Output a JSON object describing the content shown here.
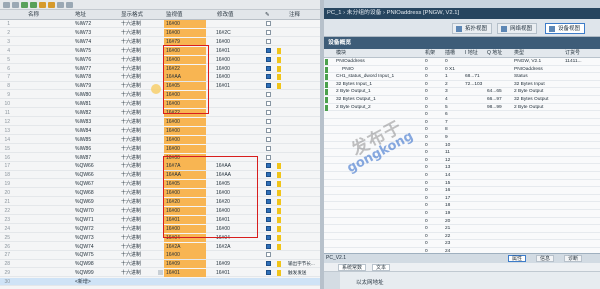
{
  "watch": {
    "headers": [
      "名称",
      "地址",
      "显示格式",
      "监视值",
      "修改值",
      "注释"
    ],
    "rows": [
      {
        "n": "1",
        "addr": "%IW72",
        "fmt": "十六进制",
        "mon": "16#00",
        "mod": "",
        "cb": false,
        "warn": false,
        "note": ""
      },
      {
        "n": "2",
        "addr": "%IW73",
        "fmt": "十六进制",
        "mon": "16#00",
        "mod": "16#2C",
        "cb": false,
        "warn": false,
        "note": ""
      },
      {
        "n": "3",
        "addr": "%IW74",
        "fmt": "十六进制",
        "mon": "16#79",
        "mod": "16#00",
        "cb": false,
        "warn": false,
        "note": ""
      },
      {
        "n": "4",
        "addr": "%IW75",
        "fmt": "十六进制",
        "mon": "16#00",
        "mod": "16#01",
        "cb": true,
        "warn": true,
        "note": ""
      },
      {
        "n": "5",
        "addr": "%IW76",
        "fmt": "十六进制",
        "mon": "16#00",
        "mod": "16#00",
        "cb": true,
        "warn": true,
        "note": ""
      },
      {
        "n": "6",
        "addr": "%IW77",
        "fmt": "十六进制",
        "mon": "16#22",
        "mod": "16#00",
        "cb": true,
        "warn": true,
        "note": ""
      },
      {
        "n": "7",
        "addr": "%IW78",
        "fmt": "十六进制",
        "mon": "16#AA",
        "mod": "16#00",
        "cb": true,
        "warn": true,
        "note": ""
      },
      {
        "n": "8",
        "addr": "%IW79",
        "fmt": "十六进制",
        "mon": "16#05",
        "mod": "16#01",
        "cb": true,
        "warn": true,
        "note": ""
      },
      {
        "n": "9",
        "addr": "%IW80",
        "fmt": "十六进制",
        "mon": "16#00",
        "mod": "",
        "cb": false,
        "warn": false,
        "note": ""
      },
      {
        "n": "10",
        "addr": "%IW81",
        "fmt": "十六进制",
        "mon": "16#00",
        "mod": "",
        "cb": false,
        "warn": false,
        "note": ""
      },
      {
        "n": "11",
        "addr": "%IW82",
        "fmt": "十六进制",
        "mon": "16#22",
        "mod": "",
        "cb": false,
        "warn": false,
        "note": ""
      },
      {
        "n": "12",
        "addr": "%IW83",
        "fmt": "十六进制",
        "mon": "16#00",
        "mod": "",
        "cb": false,
        "warn": false,
        "note": ""
      },
      {
        "n": "13",
        "addr": "%IW84",
        "fmt": "十六进制",
        "mon": "16#00",
        "mod": "",
        "cb": false,
        "warn": false,
        "note": ""
      },
      {
        "n": "14",
        "addr": "%IW85",
        "fmt": "十六进制",
        "mon": "16#00",
        "mod": "",
        "cb": false,
        "warn": false,
        "note": ""
      },
      {
        "n": "15",
        "addr": "%IW86",
        "fmt": "十六进制",
        "mon": "16#00",
        "mod": "",
        "cb": false,
        "warn": false,
        "note": ""
      },
      {
        "n": "16",
        "addr": "%IW87",
        "fmt": "十六进制",
        "mon": "16#00",
        "mod": "",
        "cb": false,
        "warn": false,
        "note": ""
      },
      {
        "n": "17",
        "addr": "%QW66",
        "fmt": "十六进制",
        "mon": "16#7A",
        "mod": "16#AA",
        "cb": true,
        "warn": true,
        "note": ""
      },
      {
        "n": "18",
        "addr": "%QW66",
        "fmt": "十六进制",
        "mon": "16#AA",
        "mod": "16#AA",
        "cb": true,
        "warn": true,
        "note": ""
      },
      {
        "n": "19",
        "addr": "%QW67",
        "fmt": "十六进制",
        "mon": "16#05",
        "mod": "16#05",
        "cb": true,
        "warn": true,
        "note": ""
      },
      {
        "n": "20",
        "addr": "%QW68",
        "fmt": "十六进制",
        "mon": "16#00",
        "mod": "16#00",
        "cb": true,
        "warn": true,
        "note": ""
      },
      {
        "n": "21",
        "addr": "%QW69",
        "fmt": "十六进制",
        "mon": "16#20",
        "mod": "16#20",
        "cb": true,
        "warn": true,
        "note": ""
      },
      {
        "n": "22",
        "addr": "%QW70",
        "fmt": "十六进制",
        "mon": "16#00",
        "mod": "16#00",
        "cb": true,
        "warn": true,
        "note": ""
      },
      {
        "n": "23",
        "addr": "%QW71",
        "fmt": "十六进制",
        "mon": "16#01",
        "mod": "16#01",
        "cb": true,
        "warn": true,
        "note": ""
      },
      {
        "n": "24",
        "addr": "%QW72",
        "fmt": "十六进制",
        "mon": "16#00",
        "mod": "16#00",
        "cb": true,
        "warn": true,
        "note": ""
      },
      {
        "n": "25",
        "addr": "%QW73",
        "fmt": "十六进制",
        "mon": "16#04",
        "mod": "16#04",
        "cb": true,
        "warn": true,
        "note": ""
      },
      {
        "n": "26",
        "addr": "%QW74",
        "fmt": "十六进制",
        "mon": "16#2A",
        "mod": "16#2A",
        "cb": true,
        "warn": true,
        "note": ""
      },
      {
        "n": "27",
        "addr": "%QW75",
        "fmt": "十六进制",
        "mon": "16#00",
        "mod": "",
        "cb": false,
        "warn": false,
        "note": ""
      },
      {
        "n": "28",
        "addr": "%QW98",
        "fmt": "十六进制",
        "mon": "16#09",
        "mod": "16#09",
        "cb": true,
        "warn": true,
        "note": "输出字节长..."
      },
      {
        "n": "29",
        "addr": "%QW99",
        "fmt": "十六进制",
        "mon": "16#01",
        "mod": "16#01",
        "cb": true,
        "warn": true,
        "note": "触发发送"
      },
      {
        "n": "30",
        "addr": "<新增>",
        "fmt": "",
        "mon": "",
        "mod": "",
        "cb": false,
        "warn": false,
        "note": ""
      }
    ]
  },
  "device": {
    "title": "PC_1 › 未分组的设备 › PNIOaddress [PNGW, V2.1]",
    "tabs": [
      "拓扑视图",
      "网络视图",
      "设备视图"
    ],
    "active_tab": "设备视图",
    "overview_label": "设备概览",
    "headers": [
      "模块",
      "机架",
      "插槽",
      "I 地址",
      "Q 地址",
      "类型",
      "订货号"
    ],
    "rows": [
      {
        "m": "PNIOaddress",
        "r": "0",
        "s": "0",
        "i": "",
        "q": "",
        "t": "PNGW, V2.1",
        "o": "11411..."
      },
      {
        "m": "PNIO",
        "r": "0",
        "s": "0 X1",
        "i": "",
        "q": "",
        "t": "PNIOaddress",
        "o": ""
      },
      {
        "m": "CH1_status_dword Input_1",
        "r": "0",
        "s": "1",
        "i": "68...71",
        "q": "",
        "t": "Status",
        "o": ""
      },
      {
        "m": "32 Bytes Input_1",
        "r": "0",
        "s": "2",
        "i": "72...103",
        "q": "",
        "t": "32 Bytes Input",
        "o": ""
      },
      {
        "m": "2 Byte Output_1",
        "r": "0",
        "s": "3",
        "i": "",
        "q": "64...65",
        "t": "2 Byte Output",
        "o": ""
      },
      {
        "m": "32 Bytes Output_1",
        "r": "0",
        "s": "4",
        "i": "",
        "q": "66...97",
        "t": "32 Bytes Output",
        "o": ""
      },
      {
        "m": "2 Byte Output_2",
        "r": "0",
        "s": "5",
        "i": "",
        "q": "98...99",
        "t": "2 Byte Output",
        "o": ""
      },
      {
        "m": "",
        "r": "0",
        "s": "6",
        "i": "",
        "q": "",
        "t": "",
        "o": ""
      },
      {
        "m": "",
        "r": "0",
        "s": "7",
        "i": "",
        "q": "",
        "t": "",
        "o": ""
      },
      {
        "m": "",
        "r": "0",
        "s": "8",
        "i": "",
        "q": "",
        "t": "",
        "o": ""
      },
      {
        "m": "",
        "r": "0",
        "s": "9",
        "i": "",
        "q": "",
        "t": "",
        "o": ""
      },
      {
        "m": "",
        "r": "0",
        "s": "10",
        "i": "",
        "q": "",
        "t": "",
        "o": ""
      },
      {
        "m": "",
        "r": "0",
        "s": "11",
        "i": "",
        "q": "",
        "t": "",
        "o": ""
      },
      {
        "m": "",
        "r": "0",
        "s": "12",
        "i": "",
        "q": "",
        "t": "",
        "o": ""
      },
      {
        "m": "",
        "r": "0",
        "s": "13",
        "i": "",
        "q": "",
        "t": "",
        "o": ""
      },
      {
        "m": "",
        "r": "0",
        "s": "14",
        "i": "",
        "q": "",
        "t": "",
        "o": ""
      },
      {
        "m": "",
        "r": "0",
        "s": "15",
        "i": "",
        "q": "",
        "t": "",
        "o": ""
      },
      {
        "m": "",
        "r": "0",
        "s": "16",
        "i": "",
        "q": "",
        "t": "",
        "o": ""
      },
      {
        "m": "",
        "r": "0",
        "s": "17",
        "i": "",
        "q": "",
        "t": "",
        "o": ""
      },
      {
        "m": "",
        "r": "0",
        "s": "18",
        "i": "",
        "q": "",
        "t": "",
        "o": ""
      },
      {
        "m": "",
        "r": "0",
        "s": "19",
        "i": "",
        "q": "",
        "t": "",
        "o": ""
      },
      {
        "m": "",
        "r": "0",
        "s": "20",
        "i": "",
        "q": "",
        "t": "",
        "o": ""
      },
      {
        "m": "",
        "r": "0",
        "s": "21",
        "i": "",
        "q": "",
        "t": "",
        "o": ""
      },
      {
        "m": "",
        "r": "0",
        "s": "22",
        "i": "",
        "q": "",
        "t": "",
        "o": ""
      },
      {
        "m": "",
        "r": "0",
        "s": "23",
        "i": "",
        "q": "",
        "t": "",
        "o": ""
      },
      {
        "m": "",
        "r": "0",
        "s": "24",
        "i": "",
        "q": "",
        "t": "",
        "o": ""
      }
    ]
  },
  "watermark": {
    "line1": "发布于",
    "line2": "gongkong"
  },
  "props": {
    "device_label": "PC_V2.1",
    "tabs": [
      "属性",
      "信息",
      "诊断"
    ],
    "sub_tabs": [
      "系统常数",
      "文本"
    ],
    "field_label": "以太网地址"
  },
  "colors": {
    "monitor_bg": "#f8b552",
    "highlight_box": "#d81e1e",
    "title_bar": "#26455f"
  }
}
